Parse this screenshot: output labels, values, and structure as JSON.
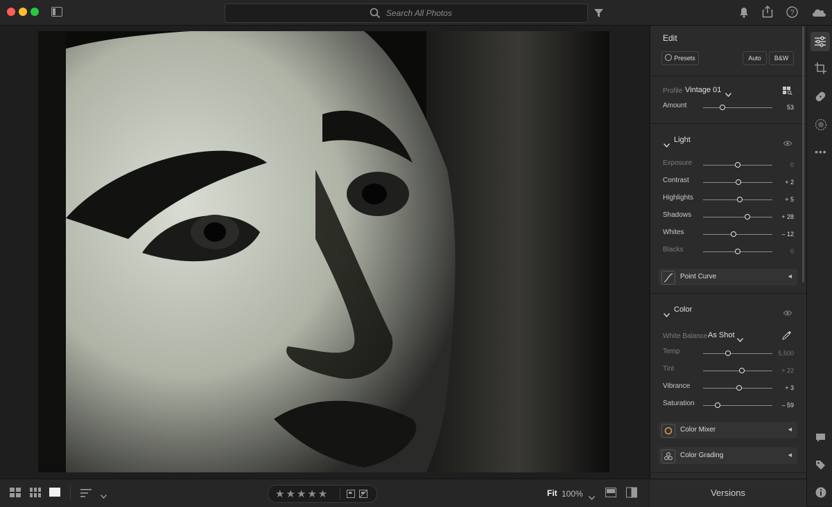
{
  "toolbar": {
    "search_placeholder": "Search All Photos"
  },
  "edit": {
    "title": "Edit",
    "presets_label": "Presets",
    "auto_label": "Auto",
    "bw_label": "B&W",
    "profile_label": "Profile",
    "profile_value": "Vintage 01",
    "amount_label": "Amount",
    "amount_value": "53"
  },
  "light": {
    "title": "Light",
    "sliders": [
      {
        "label": "Exposure",
        "value": "0",
        "position": 0.5
      },
      {
        "label": "Contrast",
        "value": "+ 2",
        "position": 0.51
      },
      {
        "label": "Highlights",
        "value": "+ 5",
        "position": 0.525
      },
      {
        "label": "Shadows",
        "value": "+ 28",
        "position": 0.64
      },
      {
        "label": "Whites",
        "value": "– 12",
        "position": 0.44
      },
      {
        "label": "Blacks",
        "value": "0",
        "position": 0.5
      }
    ],
    "point_curve_label": "Point Curve"
  },
  "color": {
    "title": "Color",
    "wb_label": "White Balance",
    "wb_value": "As Shot",
    "sliders": [
      {
        "label": "Temp",
        "value": "5,500",
        "position": 0.36
      },
      {
        "label": "Tint",
        "value": "+ 22",
        "position": 0.56
      },
      {
        "label": "Vibrance",
        "value": "+ 3",
        "position": 0.515
      },
      {
        "label": "Saturation",
        "value": "– 59",
        "position": 0.205
      }
    ],
    "color_mixer_label": "Color Mixer",
    "color_grading_label": "Color Grading"
  },
  "bottom": {
    "fit_label": "Fit",
    "zoom_value": "100%",
    "stars": 5
  },
  "versions_label": "Versions",
  "colors": {
    "close": "#fe5f57",
    "minimize": "#febc2e",
    "maximize": "#28c840"
  }
}
